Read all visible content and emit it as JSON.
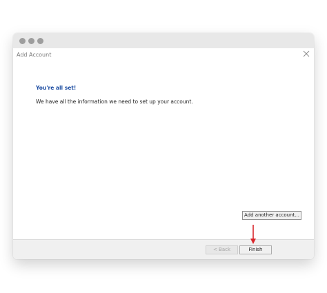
{
  "dialog": {
    "title": "Add Account",
    "heading": "You're all set!",
    "message": "We have all the information we need to set up your account.",
    "add_another_label": "Add another account...",
    "back_label": "< Back",
    "finish_label": "Finish"
  },
  "colors": {
    "heading": "#1f4fa3",
    "annotation_arrow": "#d9262b"
  },
  "icons": {
    "close": "close-icon",
    "annotation": "red-arrow-icon"
  }
}
